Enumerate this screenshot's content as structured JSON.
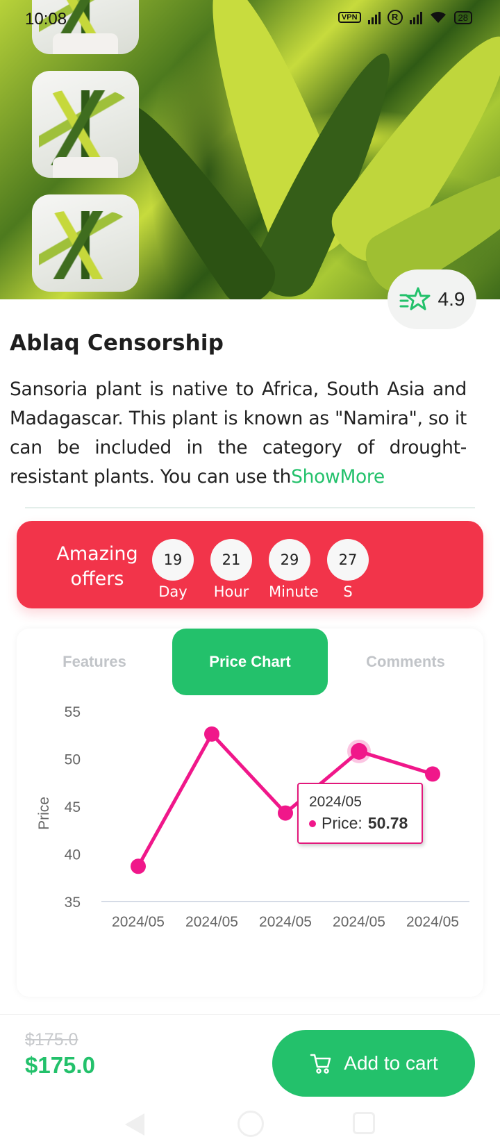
{
  "status": {
    "time": "10:08",
    "vpn": "VPN",
    "battery": "28"
  },
  "product": {
    "rating": "4.9",
    "title": "Ablaq Censorship",
    "description": "Sansoria plant is native to Africa, South Asia and Madagascar. This plant is known as \"Namira\", so it can be included in the category of drought-resistant plants. You can use th",
    "show_more": "ShowMore"
  },
  "offers": {
    "label": "Amazing offers",
    "timer": [
      {
        "value": "19",
        "unit": "Day"
      },
      {
        "value": "21",
        "unit": "Hour"
      },
      {
        "value": "29",
        "unit": "Minute"
      },
      {
        "value": "27",
        "unit": "S"
      }
    ]
  },
  "tabs": [
    {
      "label": "Features",
      "active": false
    },
    {
      "label": "Price Chart",
      "active": true
    },
    {
      "label": "Comments",
      "active": false
    }
  ],
  "chart_data": {
    "type": "line",
    "categories": [
      "2024/05",
      "2024/05",
      "2024/05",
      "2024/05",
      "2024/05"
    ],
    "series": [
      {
        "values": [
          38.7,
          52.6,
          44.3,
          50.78,
          48.4
        ]
      }
    ],
    "ylabel": "Price",
    "ylim": [
      35,
      55
    ],
    "yticks": [
      35,
      40,
      45,
      50,
      55
    ],
    "grid": false,
    "color": "#f0178a",
    "tooltip": {
      "date": "2024/05",
      "label": "Price: ",
      "value": "50.78"
    }
  },
  "pricing": {
    "old_price": "$175.0",
    "price": "$175.0",
    "cart_label": "Add to cart"
  },
  "colors": {
    "accent": "#23c16b",
    "offers": "#f2344a",
    "line": "#f0178a"
  },
  "icons": {
    "rating": "star-icon",
    "cart": "cart-icon"
  }
}
